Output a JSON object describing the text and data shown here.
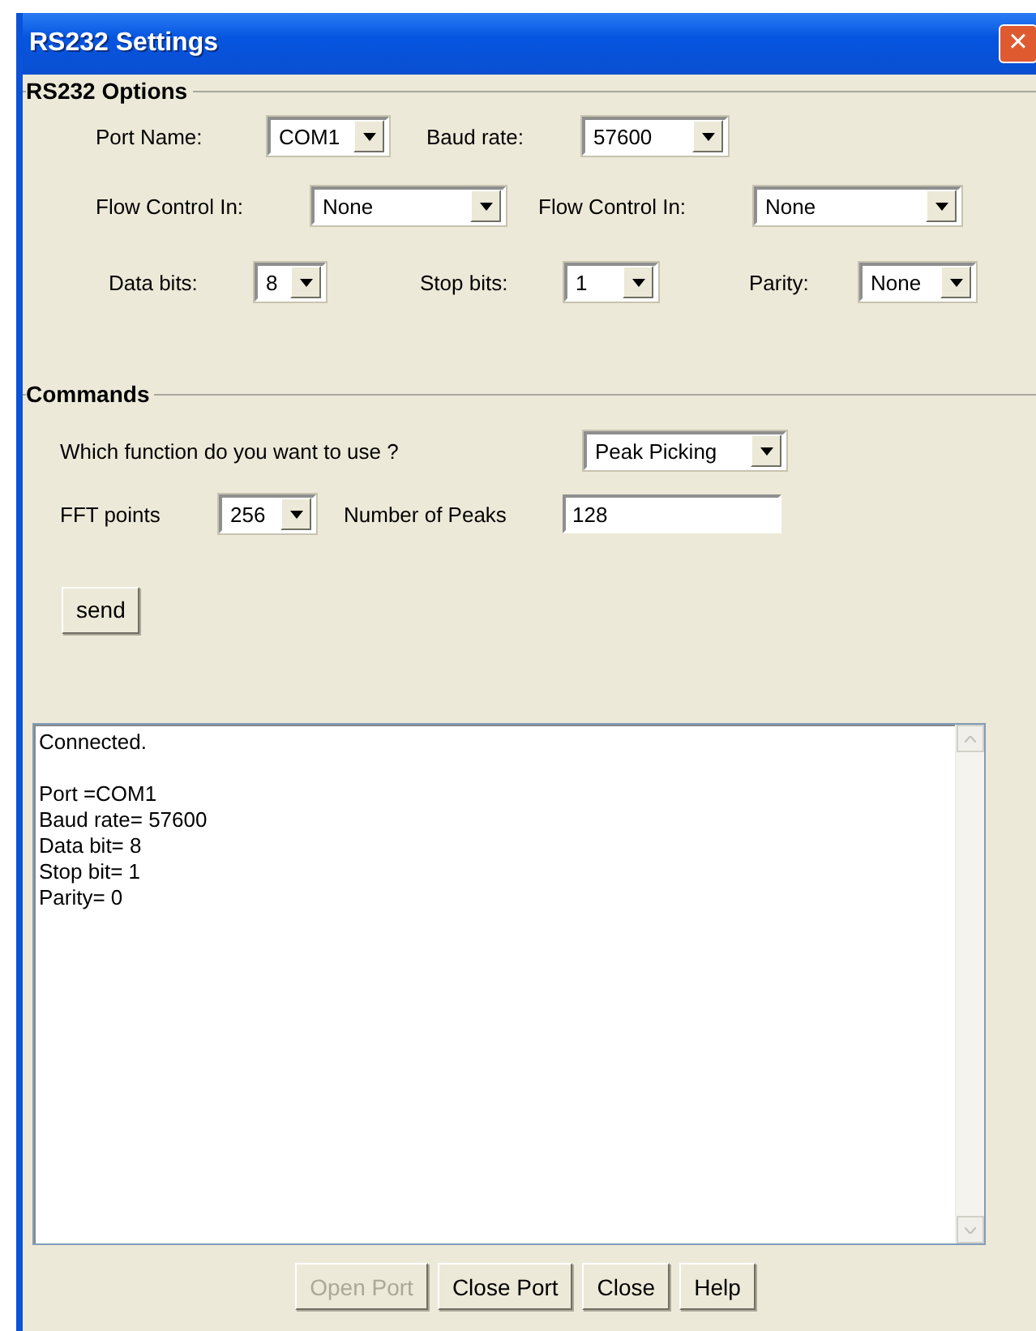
{
  "window": {
    "title": "RS232 Settings",
    "close_icon": "×"
  },
  "rs232_options": {
    "title": "RS232 Options",
    "rows": [
      [
        {
          "label": "Port Name:",
          "value": "COM1"
        },
        {
          "label": "Baud rate:",
          "value": "57600"
        }
      ],
      [
        {
          "label": "Flow Control In:",
          "value": "None"
        },
        {
          "label": "Flow Control In:",
          "value": "None"
        }
      ],
      [
        {
          "label": "Data bits:",
          "value": "8"
        },
        {
          "label": "Stop bits:",
          "value": "1"
        },
        {
          "label": "Parity:",
          "value": "None"
        }
      ]
    ]
  },
  "commands": {
    "title": "Commands",
    "rows": [
      [
        {
          "kind": "combo",
          "label": "Which function do you want to use ?",
          "value": "Peak Picking"
        }
      ],
      [
        {
          "kind": "combo",
          "label": "FFT points",
          "value": "256"
        },
        {
          "kind": "text",
          "label": "Number of Peaks",
          "value": "128"
        }
      ]
    ],
    "send_button": "send"
  },
  "output": {
    "paragraphs": [
      [
        "Connected."
      ],
      [
        "Port =COM1",
        "Baud rate= 57600",
        "Data bit= 8",
        "Stop bit= 1",
        "Parity= 0"
      ]
    ]
  },
  "buttons": [
    {
      "label": "Open Port",
      "disabled": true
    },
    {
      "label": "Close Port",
      "disabled": false
    },
    {
      "label": "Close",
      "disabled": false
    },
    {
      "label": "Help",
      "disabled": false
    }
  ]
}
